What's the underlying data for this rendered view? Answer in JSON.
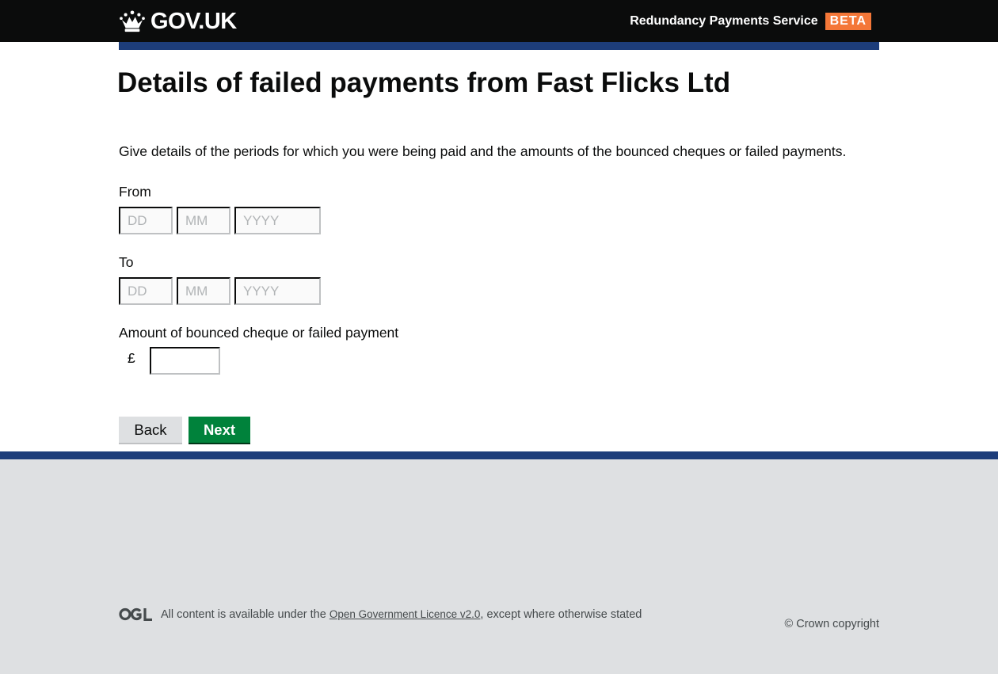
{
  "header": {
    "logo_text": "GOV.UK",
    "service_name": "Redundancy Payments Service",
    "phase_tag": "BETA"
  },
  "page": {
    "title": "Details of failed payments from Fast Flicks Ltd",
    "intro": "Give details of the periods for which you were being paid and the amounts of the bounced cheques or failed payments."
  },
  "form": {
    "from": {
      "label": "From",
      "day_placeholder": "DD",
      "month_placeholder": "MM",
      "year_placeholder": "YYYY",
      "day_value": "",
      "month_value": "",
      "year_value": ""
    },
    "to": {
      "label": "To",
      "day_placeholder": "DD",
      "month_placeholder": "MM",
      "year_placeholder": "YYYY",
      "day_value": "",
      "month_value": "",
      "year_value": ""
    },
    "amount": {
      "label": "Amount of bounced cheque or failed payment",
      "currency": "£",
      "value": ""
    },
    "back_label": "Back",
    "next_label": "Next"
  },
  "footer": {
    "licence_prefix": "All content is available under the ",
    "licence_link": "Open Government Licence v2.0",
    "licence_suffix": ", except where otherwise stated",
    "copyright": "© Crown copyright"
  },
  "colors": {
    "header_bg": "#0b0c0c",
    "brand_bar": "#1d3d7a",
    "phase_tag": "#f47738",
    "next_button": "#00823b",
    "back_button": "#dee0e2",
    "footer_bg": "#dee0e2"
  },
  "icons": {
    "logo": "crown-icon",
    "licence": "ogl-logo-icon"
  }
}
